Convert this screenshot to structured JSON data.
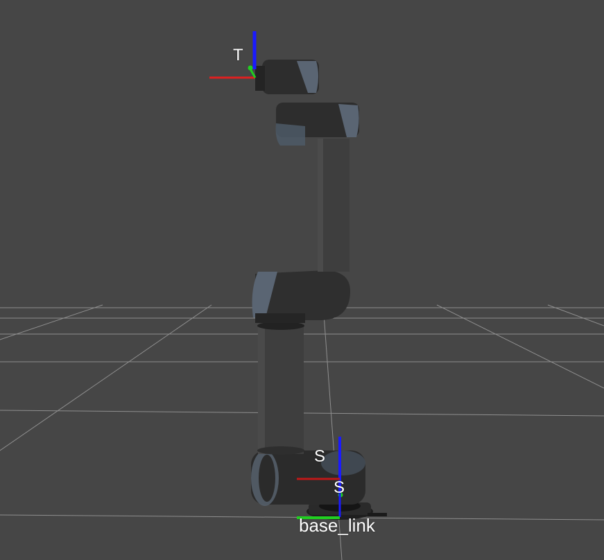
{
  "scene": {
    "background_color": "#464646",
    "grid_color": "#a8a8a8",
    "axis_colors": {
      "x": "#e02020",
      "y": "#20d020",
      "z": "#1a1aff"
    },
    "robot_color": "#2b2b2b",
    "joint_cap_color": "#5a6a7a"
  },
  "frames": {
    "tool_label": "T",
    "shoulder_label_top": "S",
    "shoulder_label_bottom": "S",
    "base_label": "base_link"
  }
}
